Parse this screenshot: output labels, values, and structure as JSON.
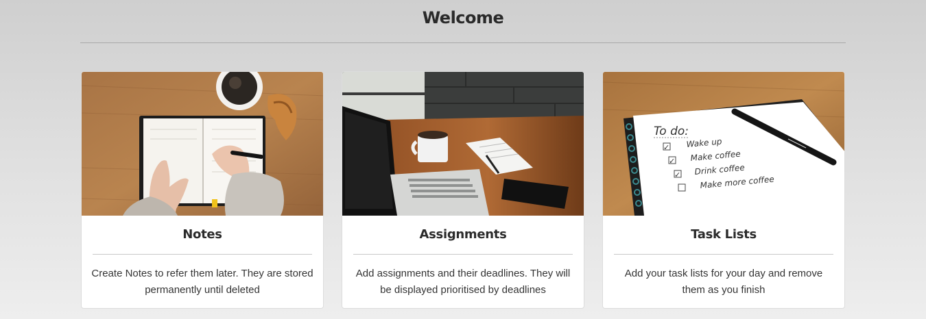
{
  "header": {
    "title": "Welcome"
  },
  "cards": [
    {
      "title": "Notes",
      "description": "Create Notes to refer them later. They are stored permanently until deleted",
      "image_icon": "notebook-writing-photo"
    },
    {
      "title": "Assignments",
      "description": "Add assignments and their deadlines. They will be displayed prioritised by deadlines",
      "image_icon": "laptop-desk-photo"
    },
    {
      "title": "Task Lists",
      "description": "Add your task lists for your day and remove them as you finish",
      "image_icon": "todo-list-photo",
      "list_heading": "To do:",
      "list_items": [
        "Wake up",
        "Make coffee",
        "Drink coffee",
        "Make more coffee"
      ]
    }
  ]
}
